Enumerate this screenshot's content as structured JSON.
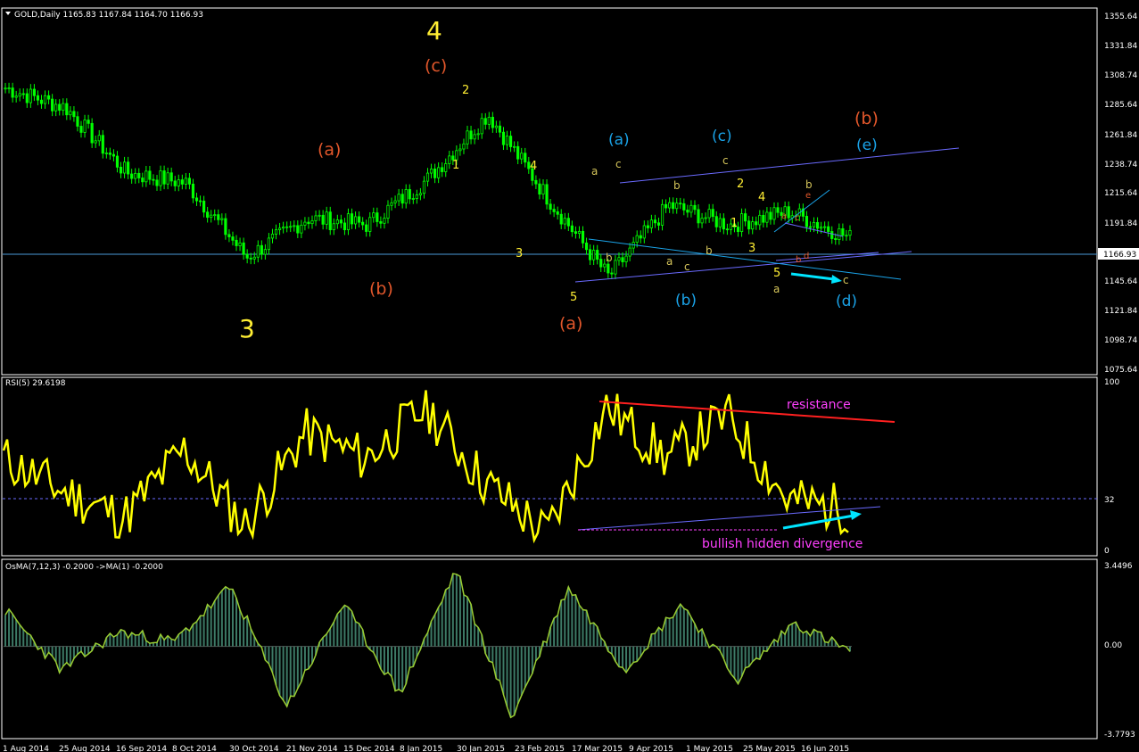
{
  "colors": {
    "background": "#000000",
    "frame": "#ffffff",
    "bull_candle": "#00ff00",
    "price_line": "#4a9ad8",
    "rsi": "#ffff00",
    "osma": "#9acd32",
    "wave_red": "#e2572b",
    "wave_blue": "#1aa3e8",
    "wave_yellow": "#ffee33",
    "resistance": "#ff2020",
    "channel": "#6a6aff",
    "arrow": "#00e5ff",
    "magenta_text": "#ff40ff"
  },
  "main_panel": {
    "header": "GOLD,Daily  1165.83 1167.84 1164.70 1166.93",
    "price_ticks": [
      "1355.64",
      "1331.84",
      "1308.74",
      "1285.64",
      "1261.84",
      "1238.74",
      "1215.64",
      "1191.84",
      "1168.74",
      "1145.64",
      "1121.84",
      "1098.74",
      "1075.64"
    ],
    "current_price": "1166.93"
  },
  "rsi_panel": {
    "header": "RSI(5) 29.6198",
    "ticks": [
      "100",
      "32",
      "0"
    ],
    "resistance_label": "resistance",
    "divergence_label": "bullish hidden divergence"
  },
  "osma_panel": {
    "header": "OsMA(7,12,3) -0.2000  ->MA(1) -0.2000",
    "ticks": [
      "3.4496",
      "0.00",
      "-3.7793"
    ]
  },
  "x_axis": [
    "1 Aug 2014",
    "25 Aug 2014",
    "16 Sep 2014",
    "8 Oct 2014",
    "30 Oct 2014",
    "21 Nov 2014",
    "15 Dec 2014",
    "8 Jan 2015",
    "30 Jan 2015",
    "23 Feb 2015",
    "17 Mar 2015",
    "9 Apr 2015",
    "1 May 2015",
    "25 May 2015",
    "16 Jun 2015"
  ],
  "wave_labels": {
    "w3": "3",
    "w4": "4",
    "red_c": "(c)",
    "red_a": "(a)",
    "red_b": "(b)",
    "red_a2": "(a)",
    "red_b2": "(b)",
    "blue_a": "(a)",
    "blue_c": "(c)",
    "blue_e": "(e)",
    "blue_b": "(b)",
    "blue_d": "(d)",
    "y2": "2",
    "y1": "1",
    "y4": "4",
    "y3": "3",
    "y5": "5",
    "s_a": "a",
    "s_c": "c",
    "s_b": "b",
    "s_a2": "a",
    "s_c2": "c",
    "s_b2": "b",
    "s_b3": "b",
    "s_c3": "c",
    "s_2": "2",
    "s_4": "4",
    "s_1": "1",
    "s_3": "3",
    "s_5": "5",
    "s_a3": "a",
    "s_b4": "b",
    "s_c4": "c",
    "s_a4": "a",
    "s_e": "e",
    "s_b5": "b",
    "s_d": "d",
    "s_c5": "c"
  },
  "chart_data": [
    {
      "type": "line",
      "title": "GOLD,Daily",
      "x": [
        "1 Aug 2014",
        "25 Aug 2014",
        "16 Sep 2014",
        "8 Oct 2014",
        "30 Oct 2014",
        "21 Nov 2014",
        "15 Dec 2014",
        "8 Jan 2015",
        "30 Jan 2015",
        "23 Feb 2015",
        "17 Mar 2015",
        "9 Apr 2015",
        "1 May 2015",
        "25 May 2015",
        "16 Jun 2015"
      ],
      "series": [
        {
          "values": [
            1295,
            1280,
            1230,
            1222,
            1165,
            1195,
            1190,
            1225,
            1275,
            1210,
            1150,
            1205,
            1190,
            1200,
            1180
          ]
        }
      ],
      "ylim": [
        1075.64,
        1355.64
      ],
      "grid": false
    },
    {
      "type": "line",
      "title": "RSI(5) 29.6198",
      "series": [
        {
          "values": [
            55,
            35,
            20,
            60,
            15,
            70,
            55,
            85,
            40,
            10,
            85,
            55,
            80,
            30,
            25
          ]
        }
      ],
      "ylim": [
        0,
        100
      ],
      "grid": false
    },
    {
      "type": "bar",
      "title": "OsMA(7,12,3) -0.2000  ->MA(1) -0.2000",
      "series": [
        {
          "values": [
            1.5,
            -1.0,
            0.6,
            0.2,
            2.5,
            -2.5,
            1.8,
            -2.0,
            3.2,
            -3.0,
            2.5,
            -1.0,
            1.8,
            -1.4,
            1.0,
            -0.2
          ]
        }
      ],
      "ylim": [
        -3.7793,
        3.4496
      ],
      "grid": false
    }
  ]
}
